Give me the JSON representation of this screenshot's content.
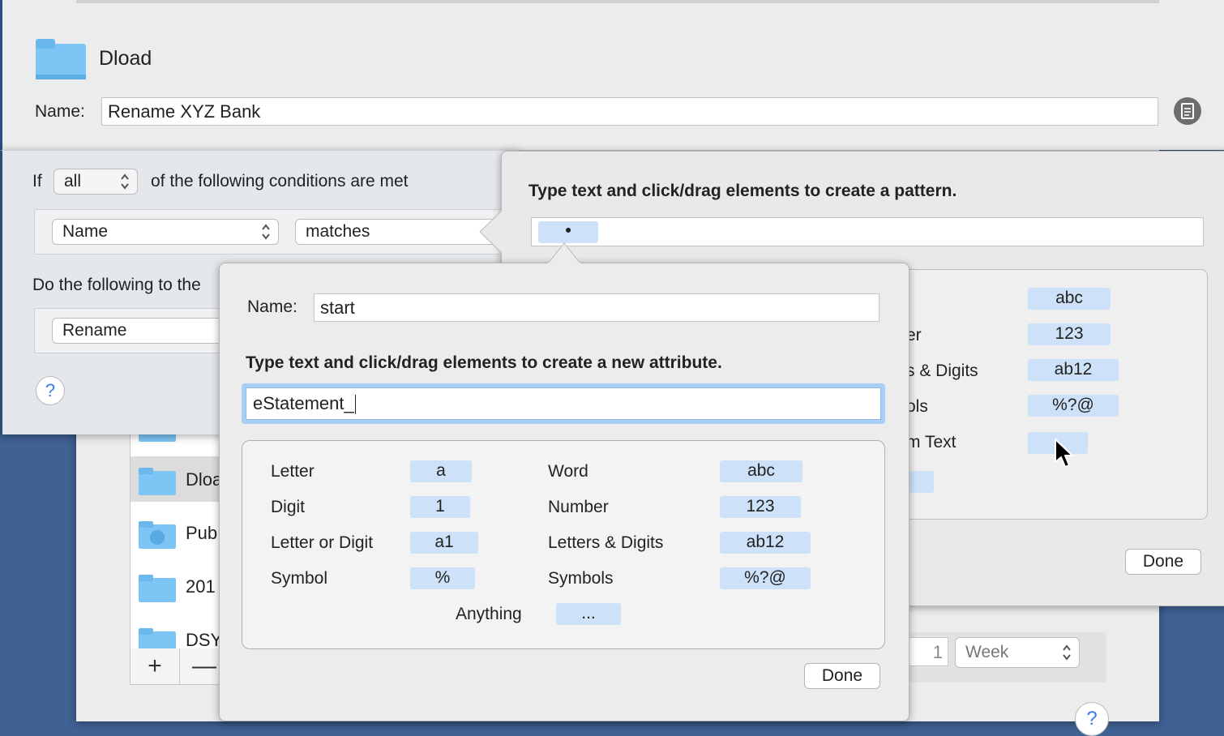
{
  "background_window": {
    "sidebar_items": [
      {
        "label": ""
      },
      {
        "label": "Dloa",
        "selected": true
      },
      {
        "label": "Pub"
      },
      {
        "label": "201"
      },
      {
        "label": "DSY"
      }
    ],
    "plus_label": "+",
    "minus_label": "—",
    "number_value": "1",
    "unit_value": "Week",
    "help_label": "?"
  },
  "rule_sheet": {
    "folder_name": "Dload",
    "name_label": "Name:",
    "name_value": "Rename XYZ Bank",
    "if_label": "If",
    "if_value": "all",
    "conditions_text": "of the following conditions are met",
    "condition_attribute": "Name",
    "condition_operator": "matches",
    "do_text": "Do the following to the",
    "action_value": "Rename",
    "help_label": "?"
  },
  "pattern_popover": {
    "title": "Type text and click/drag elements to create a pattern.",
    "token_value": "•",
    "partial_labels": [
      "er",
      "s & Digits",
      "ols",
      "m Text"
    ],
    "tokens": [
      "abc",
      "123",
      "ab12",
      "%?@",
      ""
    ],
    "done_label": "Done"
  },
  "attribute_popover": {
    "name_label": "Name:",
    "name_value": "start",
    "title": "Type text and click/drag elements to create a new attribute.",
    "input_value": "eStatement_",
    "elements_left": [
      {
        "label": "Letter",
        "token": "a"
      },
      {
        "label": "Digit",
        "token": "1"
      },
      {
        "label": "Letter or Digit",
        "token": "a1"
      },
      {
        "label": "Symbol",
        "token": "%"
      }
    ],
    "elements_right": [
      {
        "label": "Word",
        "token": "abc"
      },
      {
        "label": "Number",
        "token": "123"
      },
      {
        "label": "Letters & Digits",
        "token": "ab12"
      },
      {
        "label": "Symbols",
        "token": "%?@"
      }
    ],
    "anything_label": "Anything",
    "anything_token": "...",
    "done_label": "Done"
  },
  "colors": {
    "desktop": "#3f6193",
    "token": "#cde2f8",
    "focus_ring": "#a8cdf6",
    "folder": "#7cc5f5"
  },
  "icons": [
    "folder-icon",
    "document-icon",
    "help-icon",
    "popup-arrows-icon",
    "mouse-cursor-icon",
    "plus-icon",
    "minus-icon"
  ]
}
